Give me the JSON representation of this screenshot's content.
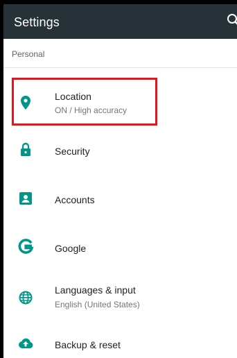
{
  "appbar": {
    "title": "Settings",
    "search_icon": "search-icon"
  },
  "section": {
    "header": "Personal"
  },
  "items": [
    {
      "label": "Location",
      "subtitle": "ON / High accuracy",
      "icon": "location-pin-icon"
    },
    {
      "label": "Security",
      "subtitle": "",
      "icon": "lock-icon"
    },
    {
      "label": "Accounts",
      "subtitle": "",
      "icon": "account-box-icon"
    },
    {
      "label": "Google",
      "subtitle": "",
      "icon": "google-g-icon"
    },
    {
      "label": "Languages & input",
      "subtitle": "English (United States)",
      "icon": "globe-icon"
    },
    {
      "label": "Backup & reset",
      "subtitle": "",
      "icon": "cloud-upload-icon"
    }
  ],
  "colors": {
    "appbar": "#263238",
    "accent": "#009688",
    "highlight": "#e5161b"
  }
}
